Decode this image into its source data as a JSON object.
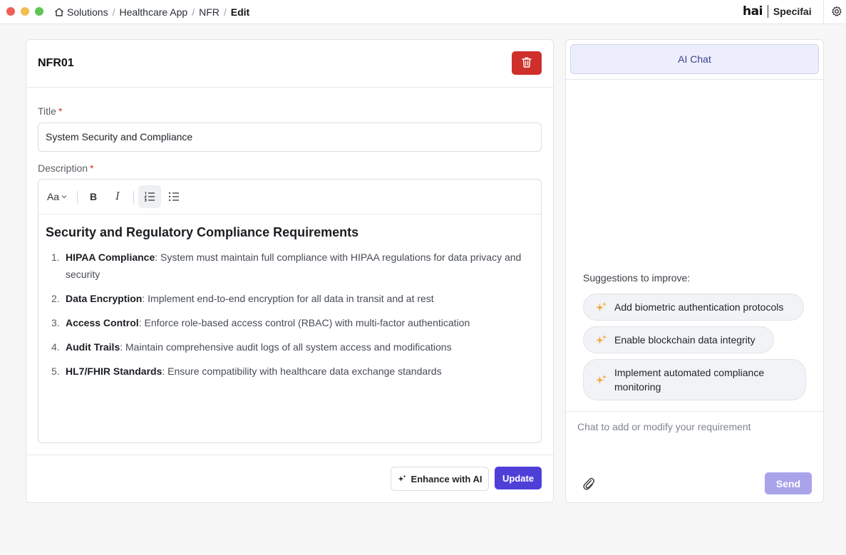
{
  "window": {
    "breadcrumbs": [
      "Solutions",
      "Healthcare App",
      "NFR",
      "Edit"
    ],
    "brand": {
      "logo_text": "hai",
      "product": "Specifai"
    }
  },
  "requirement": {
    "id": "NFR01",
    "title_label": "Title",
    "title_value": "System Security and Compliance",
    "description_label": "Description",
    "required_marker": "*",
    "toolbar": {
      "font_label": "Aa",
      "bold": "B",
      "italic": "I"
    },
    "doc_heading": "Security and Regulatory Compliance Requirements",
    "items": [
      {
        "num": "1.",
        "key": "HIPAA Compliance",
        "text": ": System must maintain full compliance with HIPAA regulations for data privacy and security"
      },
      {
        "num": "2.",
        "key": "Data Encryption",
        "text": ": Implement end-to-end encryption for all data in transit and at rest"
      },
      {
        "num": "3.",
        "key": "Access Control",
        "text": ": Enforce role-based access control (RBAC) with multi-factor authentication"
      },
      {
        "num": "4.",
        "key": "Audit Trails",
        "text": ": Maintain comprehensive audit logs of all system access and modifications"
      },
      {
        "num": "5.",
        "key": "HL7/FHIR Standards",
        "text": ": Ensure compatibility with healthcare data exchange standards"
      }
    ],
    "enhance_label": "Enhance with AI",
    "update_label": "Update"
  },
  "chat": {
    "tab_label": "AI Chat",
    "suggestions_title": "Suggestions to improve:",
    "suggestions": [
      "Add biometric authentication protocols",
      "Enable blockchain data integrity",
      "Implement automated compliance monitoring"
    ],
    "input_placeholder": "Chat to add or modify your requirement",
    "send_label": "Send"
  },
  "colors": {
    "accent": "#4f3fd9",
    "danger": "#cf2f2b",
    "send_disabled": "#a9a4ea",
    "sparkle": "#f0a93b"
  },
  "icons": [
    "home-icon",
    "trash-icon",
    "gear-icon",
    "sparkle-icon",
    "paperclip-icon",
    "chevron-down-icon",
    "ordered-list-icon",
    "bullet-list-icon"
  ]
}
